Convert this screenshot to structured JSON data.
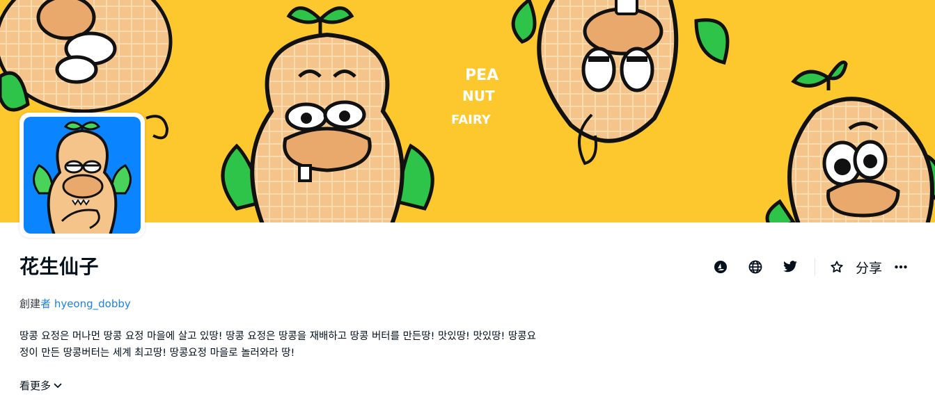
{
  "collection": {
    "name": "花生仙子",
    "creator_prefix": "創建",
    "creator_by": "者",
    "creator_name": "hyeong_dobby",
    "description_lines": [
      "땅콩 요정은 머나먼 땅콩 요정 마을에 살고 있땅! 땅콩 요정은 땅콩을 재배하고 땅콩 버터를 만든땅! 맛있땅! 맛있땅! 땅콩요",
      "정이 만든 땅콩버터는 세계 최고땅! 땅콩요정 마을로 놀러와라 땅!"
    ],
    "see_more_label": "看更多"
  },
  "banner": {
    "background": "#fdc82d",
    "logo_text": [
      "PEA",
      "NUT",
      "FAIRY"
    ]
  },
  "actions": {
    "icons": [
      "opensea-icon",
      "globe-icon",
      "twitter-icon"
    ],
    "share_label": "分享"
  },
  "colors": {
    "link": "#2081e2",
    "text": "#04111d",
    "avatar_bg": "#0a84ff",
    "peanut": "#f4c48a",
    "leaf": "#2ec44a"
  }
}
